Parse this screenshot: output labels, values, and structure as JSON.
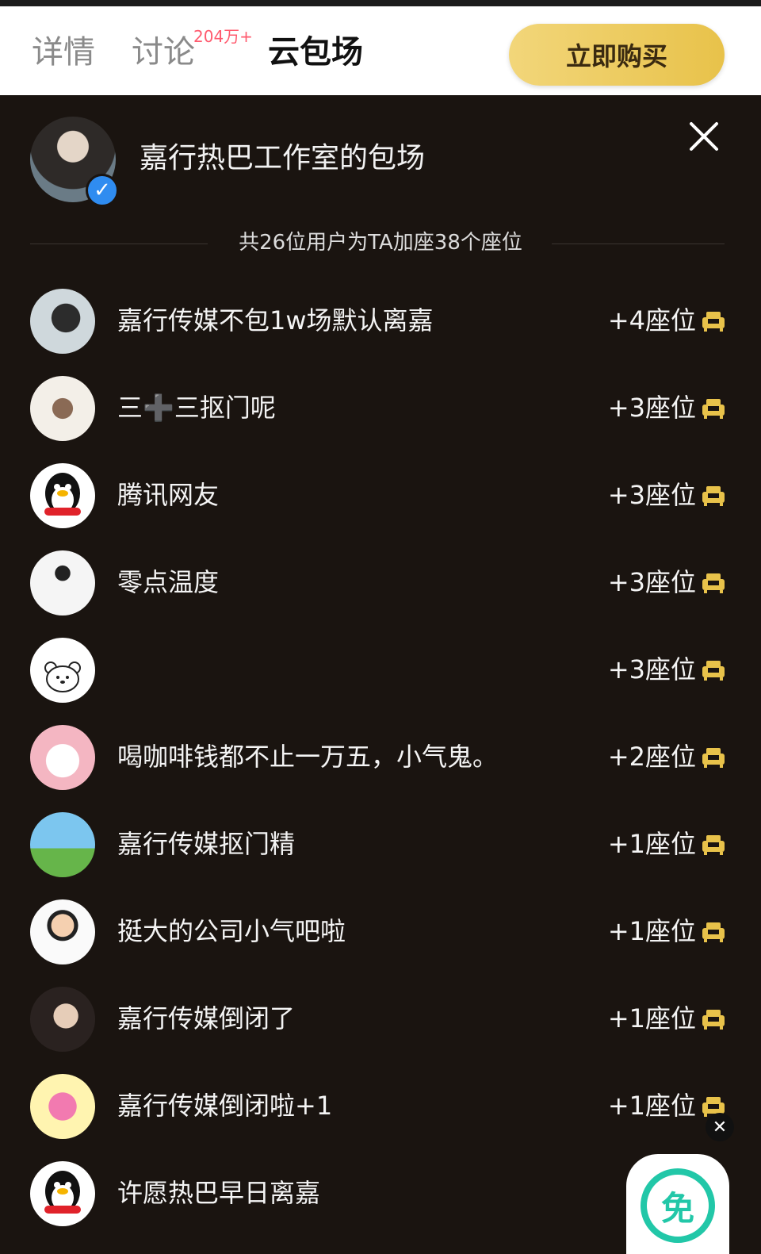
{
  "tabs": {
    "details": "详情",
    "discuss": "讨论",
    "discuss_badge": "204万+",
    "cloud": "云包场"
  },
  "buy_button": "立即购买",
  "host": {
    "title": "嘉行热巴工作室的包场"
  },
  "summary": "共26位用户为TA加座38个座位",
  "rows": [
    {
      "name": "嘉行传媒不包1w场默认离嘉",
      "seats": "+4座位"
    },
    {
      "name": "三➕三抠门呢",
      "seats": "+3座位"
    },
    {
      "name": "腾讯网友",
      "seats": "+3座位"
    },
    {
      "name": "零点温度",
      "seats": "+3座位"
    },
    {
      "name": "",
      "seats": "+3座位"
    },
    {
      "name": "喝咖啡钱都不止一万五，小气鬼。",
      "seats": "+2座位"
    },
    {
      "name": "嘉行传媒抠门精",
      "seats": "+1座位"
    },
    {
      "name": "挺大的公司小气吧啦",
      "seats": "+1座位"
    },
    {
      "name": "嘉行传媒倒闭了",
      "seats": "+1座位"
    },
    {
      "name": "嘉行传媒倒闭啦+1",
      "seats": "+1座位"
    },
    {
      "name": "许愿热巴早日离嘉",
      "seats": ""
    }
  ],
  "free_badge": "免",
  "colors": {
    "accent_gold": "#e8c24a",
    "panel_bg": "#1a1410",
    "badge_teal": "#22c7a8"
  }
}
